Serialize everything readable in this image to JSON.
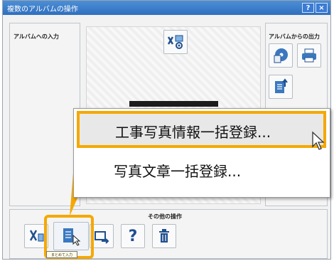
{
  "window": {
    "title": "複数のアルバムの操作",
    "help_label": "?",
    "close_label": "×"
  },
  "input_panel": {
    "label": "アルバムへの入力"
  },
  "output_panel": {
    "label": "アルバムからの出力"
  },
  "other_panel": {
    "label": "その他の操作"
  },
  "context_menu": {
    "items": [
      {
        "label": "工事写真情報一括登録...",
        "highlighted": true
      },
      {
        "label": "写真文章一括登録..."
      }
    ]
  },
  "tooltip": {
    "text": "まとめて入力"
  },
  "colors": {
    "accent": "#f5a800",
    "titlebar": "#2f6fbe",
    "icon": "#1f4f8f"
  }
}
